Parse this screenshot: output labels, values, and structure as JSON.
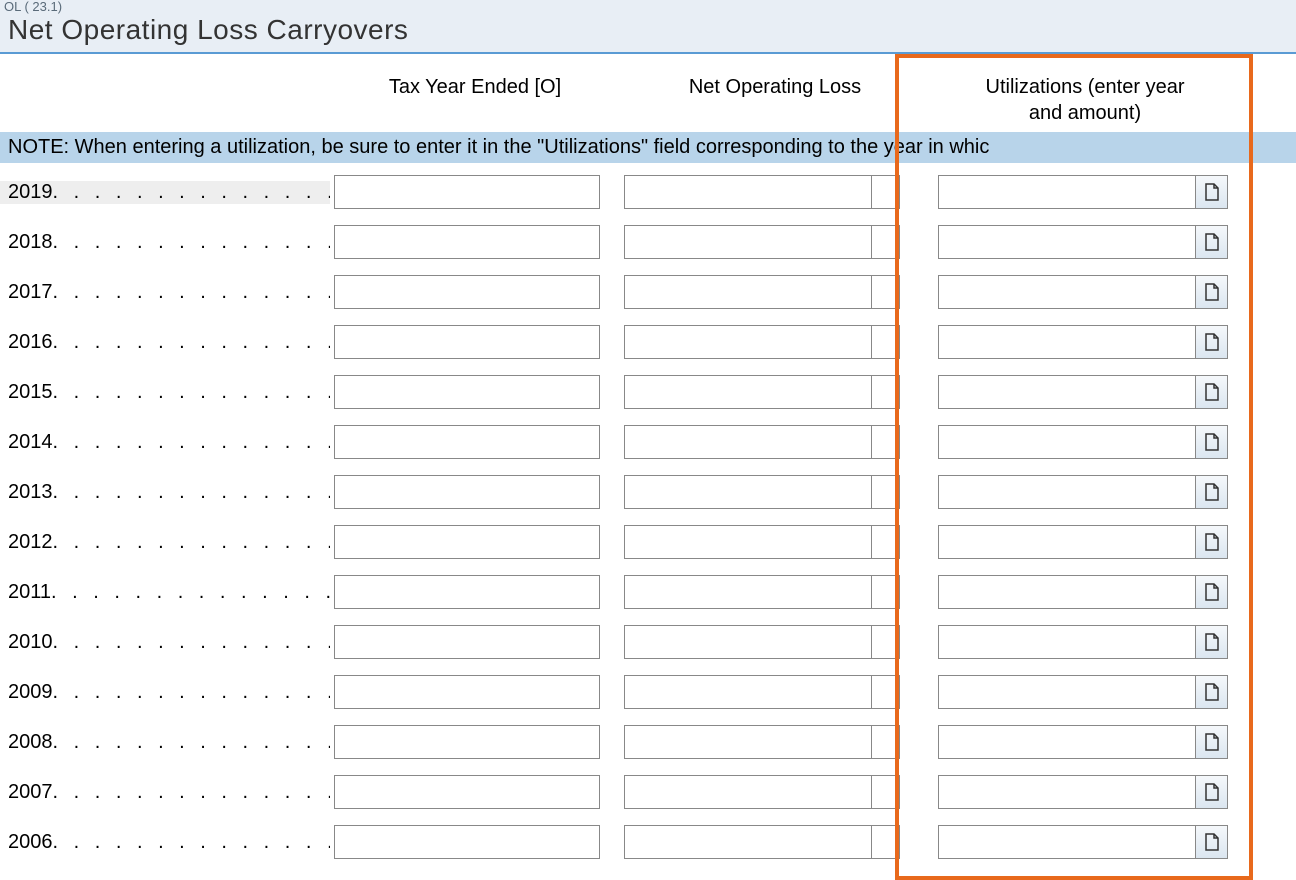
{
  "top_small_label": "OL ( 23.1)",
  "title": "Net Operating Loss Carryovers",
  "columns": {
    "tax_year": "Tax Year Ended [O]",
    "nol": "Net Operating Loss",
    "util_line1": "Utilizations (enter year",
    "util_line2": "and amount)"
  },
  "note": "NOTE: When entering a utilization, be sure to enter it in the \"Utilizations\" field corresponding to the year in whic",
  "dots": ". . . . . . . . . . . . . . . .",
  "rows": [
    {
      "year": "2019",
      "tax_year_value": "",
      "nol_value": "",
      "nol_small": "",
      "util_value": "",
      "selected": true
    },
    {
      "year": "2018",
      "tax_year_value": "",
      "nol_value": "",
      "nol_small": "",
      "util_value": "",
      "selected": false
    },
    {
      "year": "2017",
      "tax_year_value": "",
      "nol_value": "",
      "nol_small": "",
      "util_value": "",
      "selected": false
    },
    {
      "year": "2016",
      "tax_year_value": "",
      "nol_value": "",
      "nol_small": "",
      "util_value": "",
      "selected": false
    },
    {
      "year": "2015",
      "tax_year_value": "",
      "nol_value": "",
      "nol_small": "",
      "util_value": "",
      "selected": false
    },
    {
      "year": "2014",
      "tax_year_value": "",
      "nol_value": "",
      "nol_small": "",
      "util_value": "",
      "selected": false
    },
    {
      "year": "2013",
      "tax_year_value": "",
      "nol_value": "",
      "nol_small": "",
      "util_value": "",
      "selected": false
    },
    {
      "year": "2012",
      "tax_year_value": "",
      "nol_value": "",
      "nol_small": "",
      "util_value": "",
      "selected": false
    },
    {
      "year": "2011",
      "tax_year_value": "",
      "nol_value": "",
      "nol_small": "",
      "util_value": "",
      "selected": false
    },
    {
      "year": "2010",
      "tax_year_value": "",
      "nol_value": "",
      "nol_small": "",
      "util_value": "",
      "selected": false
    },
    {
      "year": "2009",
      "tax_year_value": "",
      "nol_value": "",
      "nol_small": "",
      "util_value": "",
      "selected": false
    },
    {
      "year": "2008",
      "tax_year_value": "",
      "nol_value": "",
      "nol_small": "",
      "util_value": "",
      "selected": false
    },
    {
      "year": "2007",
      "tax_year_value": "",
      "nol_value": "",
      "nol_small": "",
      "util_value": "",
      "selected": false
    },
    {
      "year": "2006",
      "tax_year_value": "",
      "nol_value": "",
      "nol_small": "",
      "util_value": "",
      "selected": false
    }
  ]
}
